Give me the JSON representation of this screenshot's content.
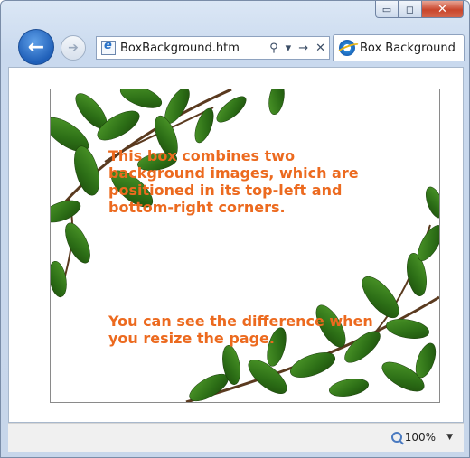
{
  "window": {
    "caption_buttons": {
      "minimize": "▭",
      "maximize": "◻",
      "close": "✕"
    }
  },
  "navigation": {
    "back_icon": "←",
    "forward_icon": "➔"
  },
  "address_bar": {
    "url": "BoxBackground.htm",
    "search_icon": "⚲",
    "dropdown_icon": "▾",
    "go_icon": "→",
    "stop_icon": "✕"
  },
  "tab": {
    "label": "Box Background"
  },
  "content": {
    "paragraph1": "This box combines two background images, which are positioned in its top-left and bottom-right corners.",
    "paragraph2": "You can see the difference when you resize the page.",
    "text_color": "#ec6a1f"
  },
  "status_bar": {
    "zoom_level": "100%",
    "zoom_dropdown_icon": "▼"
  }
}
